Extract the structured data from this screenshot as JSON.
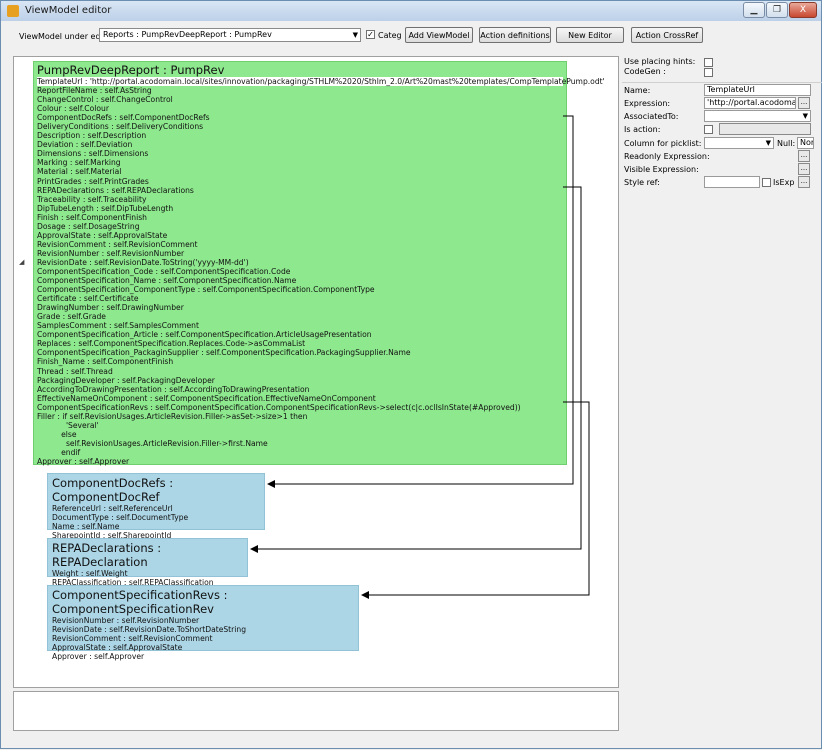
{
  "window": {
    "title": "ViewModel editor",
    "minimize_glyph": "▁",
    "restore_glyph": "❐",
    "close_glyph": "X"
  },
  "toolbar": {
    "label": "ViewModel under edit:",
    "viewmodel_value": "Reports : PumpRevDeepReport : PumpRev",
    "categ_label": "Categ",
    "categ_checked": true,
    "buttons": [
      "Add ViewModel",
      "Action definitions",
      "New Editor",
      "Action CrossRef"
    ]
  },
  "boxes": [
    {
      "title": "PumpRevDeepReport : PumpRev",
      "rows": [
        "TemplateUrl : 'http://portal.acodomain.local/sites/innovation/packaging/STHLM%2020/Sthlm_2.0/Art%20mast%20templates/CompTemplatePump.odt'",
        "ReportFileName : self.AsString",
        "ChangeControl : self.ChangeControl",
        "Colour : self.Colour",
        "ComponentDocRefs : self.ComponentDocRefs",
        "DeliveryConditions : self.DeliveryConditions",
        "Description : self.Description",
        "Deviation : self.Deviation",
        "Dimensions : self.Dimensions",
        "Marking : self.Marking",
        "Material : self.Material",
        "PrintGrades : self.PrintGrades",
        "REPADeclarations : self.REPADeclarations",
        "Traceability : self.Traceability",
        "DipTubeLength : self.DipTubeLength",
        "Finish : self.ComponentFinish",
        "Dosage : self.DosageString",
        "ApprovalState : self.ApprovalState",
        "RevisionComment : self.RevisionComment",
        "RevisionNumber : self.RevisionNumber",
        "RevisionDate : self.RevisionDate.ToString('yyyy-MM-dd')",
        "ComponentSpecification_Code : self.ComponentSpecification.Code",
        "ComponentSpecification_Name : self.ComponentSpecification.Name",
        "ComponentSpecification_ComponentType : self.ComponentSpecification.ComponentType",
        "Certificate : self.Certificate",
        "DrawingNumber : self.DrawingNumber",
        "Grade : self.Grade",
        "SamplesComment : self.SamplesComment",
        "ComponentSpecification_Article : self.ComponentSpecification.ArticleUsagePresentation",
        "Replaces : self.ComponentSpecification.Replaces.Code->asCommaList",
        "ComponentSpecification_PackaginSupplier : self.ComponentSpecification.PackagingSupplier.Name",
        "Finish_Name : self.ComponentFinish",
        "Thread : self.Thread",
        "PackagingDeveloper : self.PackagingDeveloper",
        "AccordingToDrawingPresentation : self.AccordingToDrawingPresentation",
        "EffectiveNameOnComponent : self.ComponentSpecification.EffectiveNameOnComponent",
        "ComponentSpecificationRevs : self.ComponentSpecification.ComponentSpecificationRevs->select(c|c.oclIsInState(#Approved))",
        "Filler : if self.RevisionUsages.ArticleRevision.Filler->asSet->size>1 then",
        "            'Several'",
        "          else",
        "            self.RevisionUsages.ArticleRevision.Filler->first.Name",
        "          endif",
        "Approver : self.Approver"
      ]
    },
    {
      "title": "ComponentDocRefs : ComponentDocRef",
      "rows": [
        "ReferenceUrl : self.ReferenceUrl",
        "DocumentType : self.DocumentType",
        "Name : self.Name",
        "SharepointId : self.SharepointId"
      ]
    },
    {
      "title": "REPADeclarations : REPADeclaration",
      "rows": [
        "Weight : self.Weight",
        "REPAClassification : self.REPAClassification"
      ]
    },
    {
      "title": "ComponentSpecificationRevs : ComponentSpecificationRev",
      "rows": [
        "RevisionNumber : self.RevisionNumber",
        "RevisionDate : self.RevisionDate.ToShortDateString",
        "RevisionComment : self.RevisionComment",
        "ApprovalState : self.ApprovalState",
        "Approver : self.Approver"
      ]
    }
  ],
  "properties": {
    "use_placing_hints_label": "Use placing hints:",
    "codegen_label": "CodeGen :",
    "name_label": "Name:",
    "name_value": "TemplateUrl",
    "expression_label": "Expression:",
    "expression_value": "'http://portal.acodomain.lo",
    "associated_to_label": "AssociatedTo:",
    "is_action_label": "Is action:",
    "column_for_picklist_label": "Column for picklist:",
    "null_label": "Null:",
    "null_value": "Nor",
    "readonly_expression_label": "Readonly Expression:",
    "visible_expression_label": "Visible Expression:",
    "style_ref_label": "Style ref:",
    "isexp_label": "IsExp",
    "ellipsis": "..."
  },
  "colors": {
    "green_box": "#8ee88e",
    "blue_box": "#acd6e6"
  }
}
